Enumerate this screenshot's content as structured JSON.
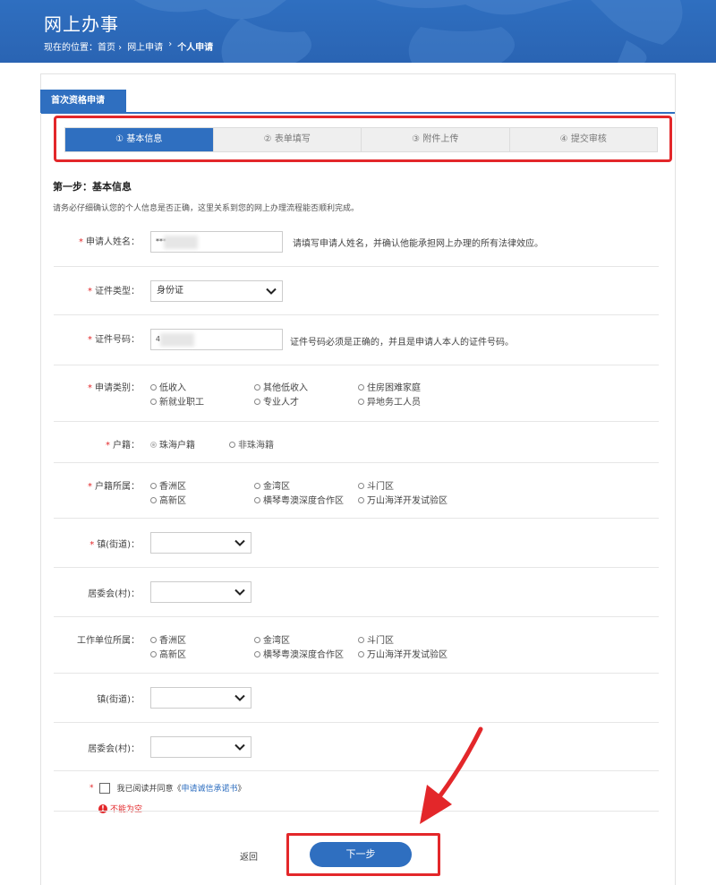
{
  "header": {
    "title": "网上办事",
    "breadcrumb_prefix": "现在的位置：首页 ›",
    "breadcrumb_mid": "网上申请",
    "breadcrumb_sep": "›",
    "breadcrumb_current": "个人申请"
  },
  "panel": {
    "tab_label": "首次资格申请"
  },
  "steps": [
    {
      "label": "① 基本信息",
      "active": true
    },
    {
      "label": "② 表单填写",
      "active": false
    },
    {
      "label": "③ 附件上传",
      "active": false
    },
    {
      "label": "④ 提交审核",
      "active": false
    }
  ],
  "section": {
    "title": "第一步：基本信息",
    "desc": "请务必仔细确认您的个人信息是否正确，这里关系到您的网上办理流程能否顺利完成。"
  },
  "form": {
    "name_label": "申请人姓名：",
    "name_value": "***",
    "name_hint": "请填写申请人姓名，并确认他能承担网上办理的所有法律效应。",
    "id_type_label": "证件类型：",
    "id_type_value": "身份证",
    "id_no_label": "证件号码：",
    "id_no_value": "4",
    "id_no_hint": "证件号码必须是正确的，并且是申请人本人的证件号码。",
    "category_label": "申请类别：",
    "category_options": [
      "低收入",
      "其他低收入",
      "住房困难家庭",
      "新就业职工",
      "专业人才",
      "异地务工人员"
    ],
    "hukou_label": "户籍：",
    "hukou_options": [
      "珠海户籍",
      "非珠海籍"
    ],
    "hukou_district_label": "户籍所属：",
    "district_options": [
      "香洲区",
      "金湾区",
      "斗门区",
      "高新区",
      "横琴粤澳深度合作区",
      "万山海洋开发试验区"
    ],
    "town_label": "镇(街道)：",
    "committee_label": "居委会(村)：",
    "work_district_label": "工作单位所属：",
    "work_district_options": [
      "香洲区",
      "金湾区",
      "斗门区",
      "高新区",
      "横琴粤澳深度合作区",
      "万山海洋开发试验区"
    ],
    "work_town_label": "镇(街道)：",
    "work_committee_label": "居委会(村)：",
    "required_mark": "*"
  },
  "agree": {
    "text": "我已阅读并同意《",
    "link": "申请诚信承诺书",
    "text_end": "》",
    "error": "不能为空",
    "error_icon": "!"
  },
  "buttons": {
    "back": "返回",
    "next": "下一步"
  },
  "colors": {
    "primary": "#2f6fc0",
    "highlight_red": "#e3272a"
  }
}
